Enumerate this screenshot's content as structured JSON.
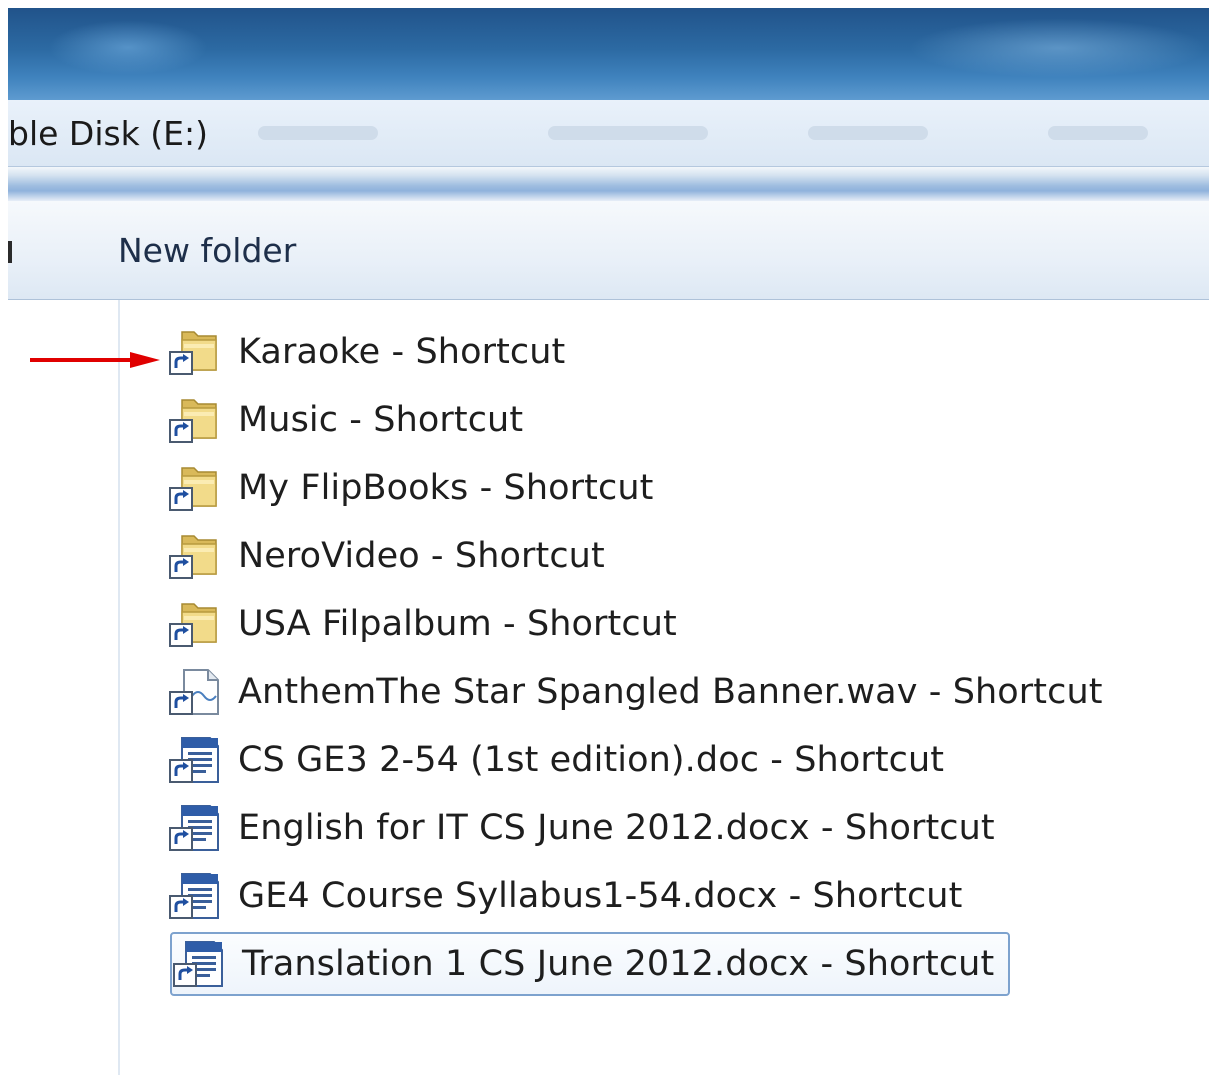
{
  "address": {
    "path_text": "ble Disk (E:)"
  },
  "toolbar": {
    "new_folder_label": "New folder"
  },
  "files": [
    {
      "name": "Karaoke - Shortcut",
      "type": "folder-shortcut"
    },
    {
      "name": "Music - Shortcut",
      "type": "folder-shortcut"
    },
    {
      "name": "My FlipBooks - Shortcut",
      "type": "folder-shortcut"
    },
    {
      "name": "NeroVideo - Shortcut",
      "type": "folder-shortcut"
    },
    {
      "name": "USA Filpalbum - Shortcut",
      "type": "folder-shortcut"
    },
    {
      "name": "AnthemThe Star Spangled Banner.wav - Shortcut",
      "type": "file-shortcut"
    },
    {
      "name": "CS GE3 2-54 (1st edition).doc - Shortcut",
      "type": "doc-shortcut"
    },
    {
      "name": "English for IT CS June 2012.docx - Shortcut",
      "type": "doc-shortcut"
    },
    {
      "name": "GE4  Course Syllabus1-54.docx - Shortcut",
      "type": "doc-shortcut"
    },
    {
      "name": "Translation 1 CS June 2012.docx - Shortcut",
      "type": "doc-shortcut",
      "selected": true
    }
  ],
  "annotation": {
    "icon": "red-arrow-icon",
    "color": "#e00000"
  },
  "colors": {
    "selection_border": "#7da2ce",
    "titlebar": "#2c6aa3"
  }
}
